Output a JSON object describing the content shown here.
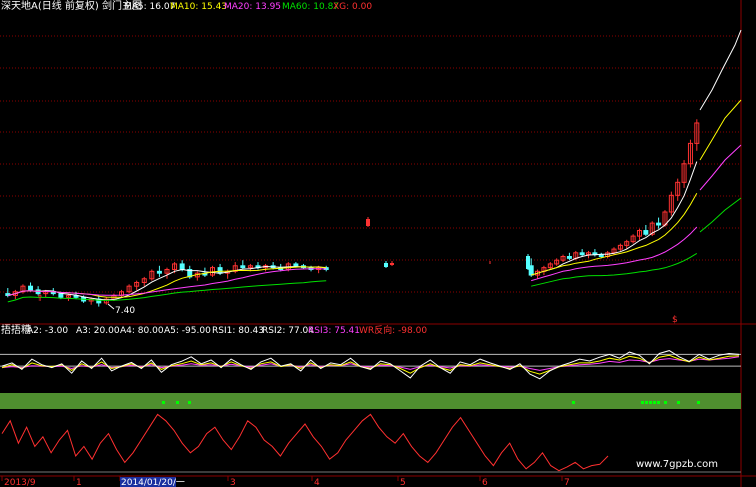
{
  "colors": {
    "background": "#000000",
    "grid": "#8b0000",
    "up_candle": "#ff3232",
    "down_candle": "#54ffff",
    "ma5": "#ffffff",
    "ma10": "#ffff00",
    "ma20": "#ff40ff",
    "ma60": "#00e000",
    "xg": "#ff3030",
    "white": "#ffffff",
    "yellow": "#ffff00",
    "magenta": "#ff40ff",
    "red": "#ff3030",
    "band": "#4f8f2f",
    "dot": "#00ff00"
  },
  "main_panel": {
    "title": "深天地A(日线 前复权) 剑门主图",
    "ma5_label": "MA5: 16.07",
    "ma10_label": "MA10: 15.43",
    "ma20_label": "MA20: 13.95",
    "ma60_label": "MA60: 10.87",
    "xg_label": "XG: 0.00",
    "low_label": "7.40",
    "marker_glyph": "$"
  },
  "indicator_panel": {
    "title": "捂捂糟",
    "a2_label": "A2: -3.00",
    "a3_label": "A3: 20.00",
    "a4_label": "A4: 80.00",
    "a5_label": "A5: -95.00",
    "rsi1_label": "RSI1: 80.43",
    "rsi2_label": "RSI2: 77.04",
    "rsi3_label": "RSI3: 75.41",
    "wr_label": "WR反向: -98.00"
  },
  "x_axis": {
    "labels": [
      "2013/9",
      "1",
      "2014/01/20/一",
      "3",
      "4",
      "5",
      "6",
      "7"
    ]
  },
  "watermark": "www.7gpzb.com",
  "chart_data": [
    {
      "type": "candlestick",
      "title": "深天地A(日线 前复权) 剑门主图",
      "series": [
        {
          "name": "MA5",
          "last": 16.07
        },
        {
          "name": "MA10",
          "last": 15.43
        },
        {
          "name": "MA20",
          "last": 13.95
        },
        {
          "name": "MA60",
          "last": 10.87
        },
        {
          "name": "XG",
          "last": 0.0
        }
      ],
      "ylim": [
        7.0,
        18.0
      ],
      "annotations": [
        "7.40"
      ],
      "candles": [
        {
          "o": 8.1,
          "h": 8.4,
          "l": 7.9,
          "c": 8.0
        },
        {
          "o": 8.0,
          "h": 8.3,
          "l": 7.8,
          "c": 8.2
        },
        {
          "o": 8.2,
          "h": 8.6,
          "l": 8.1,
          "c": 8.5
        },
        {
          "o": 8.5,
          "h": 8.7,
          "l": 8.2,
          "c": 8.3
        },
        {
          "o": 8.3,
          "h": 8.5,
          "l": 8.0,
          "c": 8.1
        },
        {
          "o": 8.1,
          "h": 8.3,
          "l": 7.9,
          "c": 8.2
        },
        {
          "o": 8.2,
          "h": 8.4,
          "l": 8.0,
          "c": 8.1
        },
        {
          "o": 8.1,
          "h": 8.2,
          "l": 7.8,
          "c": 7.9
        },
        {
          "o": 7.9,
          "h": 8.1,
          "l": 7.7,
          "c": 8.0
        },
        {
          "o": 8.0,
          "h": 8.2,
          "l": 7.8,
          "c": 7.9
        },
        {
          "o": 7.9,
          "h": 8.0,
          "l": 7.6,
          "c": 7.7
        },
        {
          "o": 7.7,
          "h": 7.9,
          "l": 7.5,
          "c": 7.8
        },
        {
          "o": 7.8,
          "h": 8.0,
          "l": 7.4,
          "c": 7.6
        },
        {
          "o": 7.6,
          "h": 7.9,
          "l": 7.5,
          "c": 7.8
        },
        {
          "o": 7.8,
          "h": 8.1,
          "l": 7.7,
          "c": 8.0
        },
        {
          "o": 8.0,
          "h": 8.3,
          "l": 7.9,
          "c": 8.2
        },
        {
          "o": 8.2,
          "h": 8.6,
          "l": 8.1,
          "c": 8.5
        },
        {
          "o": 8.5,
          "h": 8.8,
          "l": 8.3,
          "c": 8.7
        },
        {
          "o": 8.7,
          "h": 9.0,
          "l": 8.5,
          "c": 8.9
        },
        {
          "o": 8.9,
          "h": 9.4,
          "l": 8.8,
          "c": 9.3
        },
        {
          "o": 9.3,
          "h": 9.6,
          "l": 9.0,
          "c": 9.2
        },
        {
          "o": 9.2,
          "h": 9.5,
          "l": 8.9,
          "c": 9.4
        },
        {
          "o": 9.4,
          "h": 9.8,
          "l": 9.2,
          "c": 9.7
        },
        {
          "o": 9.7,
          "h": 9.9,
          "l": 9.3,
          "c": 9.4
        },
        {
          "o": 9.4,
          "h": 9.6,
          "l": 8.9,
          "c": 9.0
        },
        {
          "o": 9.0,
          "h": 9.3,
          "l": 8.8,
          "c": 9.2
        },
        {
          "o": 9.2,
          "h": 9.5,
          "l": 9.0,
          "c": 9.1
        },
        {
          "o": 9.1,
          "h": 9.6,
          "l": 9.0,
          "c": 9.5
        },
        {
          "o": 9.5,
          "h": 9.7,
          "l": 9.1,
          "c": 9.2
        },
        {
          "o": 9.2,
          "h": 9.4,
          "l": 8.9,
          "c": 9.3
        },
        {
          "o": 9.3,
          "h": 9.8,
          "l": 9.2,
          "c": 9.6
        },
        {
          "o": 9.6,
          "h": 9.9,
          "l": 9.4,
          "c": 9.5
        },
        {
          "o": 9.5,
          "h": 9.7,
          "l": 9.3,
          "c": 9.6
        },
        {
          "o": 9.6,
          "h": 9.8,
          "l": 9.4,
          "c": 9.5
        },
        {
          "o": 9.5,
          "h": 9.7,
          "l": 9.3,
          "c": 9.6
        },
        {
          "o": 9.6,
          "h": 9.8,
          "l": 9.4,
          "c": 9.5
        },
        {
          "o": 9.5,
          "h": 9.7,
          "l": 9.3,
          "c": 9.4
        },
        {
          "o": 9.4,
          "h": 9.8,
          "l": 9.3,
          "c": 9.7
        },
        {
          "o": 9.7,
          "h": 9.8,
          "l": 9.5,
          "c": 9.6
        },
        {
          "o": 9.6,
          "h": 9.7,
          "l": 9.4,
          "c": 9.5
        },
        {
          "o": 9.5,
          "h": 9.6,
          "l": 9.3,
          "c": 9.4
        },
        {
          "o": 9.4,
          "h": 9.6,
          "l": 9.2,
          "c": 9.5
        },
        {
          "o": 9.5,
          "h": 9.6,
          "l": 9.3,
          "c": 9.4
        }
      ],
      "candles_part2": [
        {
          "o": 9.6,
          "h": 10.0,
          "l": 9.0,
          "c": 9.1
        },
        {
          "o": 9.1,
          "h": 9.4,
          "l": 8.9,
          "c": 9.3
        },
        {
          "o": 9.3,
          "h": 9.6,
          "l": 9.1,
          "c": 9.5
        },
        {
          "o": 9.5,
          "h": 9.8,
          "l": 9.4,
          "c": 9.7
        },
        {
          "o": 9.7,
          "h": 10.0,
          "l": 9.6,
          "c": 9.9
        },
        {
          "o": 9.9,
          "h": 10.2,
          "l": 9.8,
          "c": 10.1
        },
        {
          "o": 10.1,
          "h": 10.3,
          "l": 9.9,
          "c": 10.0
        },
        {
          "o": 10.0,
          "h": 10.4,
          "l": 9.9,
          "c": 10.3
        },
        {
          "o": 10.3,
          "h": 10.5,
          "l": 10.1,
          "c": 10.2
        },
        {
          "o": 10.2,
          "h": 10.4,
          "l": 10.0,
          "c": 10.3
        },
        {
          "o": 10.3,
          "h": 10.5,
          "l": 10.1,
          "c": 10.2
        },
        {
          "o": 10.2,
          "h": 10.3,
          "l": 10.0,
          "c": 10.1
        },
        {
          "o": 10.1,
          "h": 10.4,
          "l": 10.0,
          "c": 10.3
        },
        {
          "o": 10.3,
          "h": 10.6,
          "l": 10.2,
          "c": 10.5
        },
        {
          "o": 10.5,
          "h": 10.8,
          "l": 10.4,
          "c": 10.7
        },
        {
          "o": 10.7,
          "h": 11.0,
          "l": 10.5,
          "c": 10.9
        },
        {
          "o": 10.9,
          "h": 11.3,
          "l": 10.8,
          "c": 11.2
        },
        {
          "o": 11.2,
          "h": 11.6,
          "l": 11.0,
          "c": 11.5
        },
        {
          "o": 11.5,
          "h": 11.8,
          "l": 11.2,
          "c": 11.3
        },
        {
          "o": 11.3,
          "h": 12.0,
          "l": 11.2,
          "c": 11.9
        },
        {
          "o": 11.9,
          "h": 12.2,
          "l": 11.6,
          "c": 11.8
        },
        {
          "o": 11.8,
          "h": 12.6,
          "l": 11.7,
          "c": 12.5
        },
        {
          "o": 12.5,
          "h": 13.6,
          "l": 12.3,
          "c": 13.4
        },
        {
          "o": 13.4,
          "h": 14.3,
          "l": 13.1,
          "c": 14.1
        },
        {
          "o": 14.1,
          "h": 15.3,
          "l": 13.8,
          "c": 15.1
        },
        {
          "o": 15.1,
          "h": 16.4,
          "l": 14.9,
          "c": 16.2
        },
        {
          "o": 16.2,
          "h": 17.5,
          "l": 15.8,
          "c": 17.3
        }
      ]
    },
    {
      "type": "line",
      "title": "捂捂糟",
      "series": [
        {
          "name": "A2",
          "last": -3.0
        },
        {
          "name": "A3",
          "last": 20.0
        },
        {
          "name": "A4",
          "last": 80.0
        },
        {
          "name": "A5",
          "last": -95.0
        },
        {
          "name": "RSI1",
          "last": 80.43,
          "values": [
            55,
            62,
            48,
            70,
            58,
            52,
            60,
            40,
            66,
            50,
            72,
            45,
            55,
            63,
            50,
            68,
            42,
            58,
            65,
            75,
            60,
            68,
            52,
            70,
            58,
            48,
            64,
            72,
            55,
            60,
            45,
            68,
            50,
            62,
            58,
            72,
            54,
            48,
            66,
            60,
            45,
            30,
            55,
            68,
            52,
            40,
            64,
            58,
            70,
            62,
            55,
            48,
            60,
            38,
            28,
            45,
            55,
            62,
            70,
            66,
            74,
            80,
            72,
            85,
            78,
            60,
            82,
            88,
            75,
            65,
            80,
            70,
            78,
            82,
            80
          ]
        },
        {
          "name": "RSI2",
          "last": 77.04,
          "values": [
            52,
            58,
            50,
            62,
            56,
            54,
            58,
            46,
            60,
            52,
            64,
            50,
            54,
            60,
            52,
            62,
            48,
            56,
            60,
            66,
            58,
            62,
            54,
            64,
            56,
            50,
            60,
            64,
            54,
            58,
            50,
            62,
            52,
            58,
            56,
            64,
            54,
            50,
            60,
            58,
            50,
            40,
            52,
            60,
            52,
            46,
            58,
            56,
            62,
            58,
            54,
            50,
            56,
            44,
            38,
            46,
            54,
            58,
            62,
            62,
            66,
            72,
            68,
            76,
            72,
            62,
            74,
            78,
            70,
            64,
            74,
            68,
            72,
            76,
            77
          ]
        },
        {
          "name": "RSI3",
          "last": 75.41,
          "values": [
            52,
            54,
            52,
            56,
            55,
            54,
            55,
            50,
            56,
            53,
            58,
            52,
            54,
            57,
            54,
            58,
            52,
            55,
            57,
            60,
            57,
            58,
            55,
            59,
            56,
            53,
            57,
            60,
            55,
            57,
            53,
            58,
            54,
            57,
            56,
            60,
            55,
            53,
            57,
            56,
            53,
            48,
            54,
            57,
            54,
            51,
            56,
            55,
            58,
            56,
            55,
            53,
            55,
            50,
            46,
            50,
            54,
            56,
            58,
            59,
            61,
            65,
            63,
            68,
            67,
            63,
            69,
            71,
            68,
            65,
            70,
            68,
            70,
            72,
            75
          ]
        },
        {
          "name": "WR反向",
          "last": -98.0,
          "values": [
            -40,
            -20,
            -55,
            -30,
            -60,
            -45,
            -70,
            -50,
            -35,
            -75,
            -60,
            -80,
            -55,
            -40,
            -65,
            -85,
            -70,
            -50,
            -30,
            -10,
            -20,
            -35,
            -55,
            -70,
            -60,
            -40,
            -30,
            -50,
            -65,
            -45,
            -20,
            -30,
            -50,
            -60,
            -75,
            -55,
            -40,
            -25,
            -45,
            -60,
            -80,
            -70,
            -50,
            -35,
            -20,
            -10,
            -30,
            -45,
            -55,
            -40,
            -60,
            -75,
            -85,
            -70,
            -50,
            -30,
            -15,
            -35,
            -55,
            -75,
            -90,
            -70,
            -55,
            -80,
            -95,
            -85,
            -70,
            -90,
            -98,
            -92,
            -85,
            -95,
            -90,
            -88,
            -75
          ]
        }
      ],
      "ylim": [
        0,
        100
      ]
    }
  ]
}
